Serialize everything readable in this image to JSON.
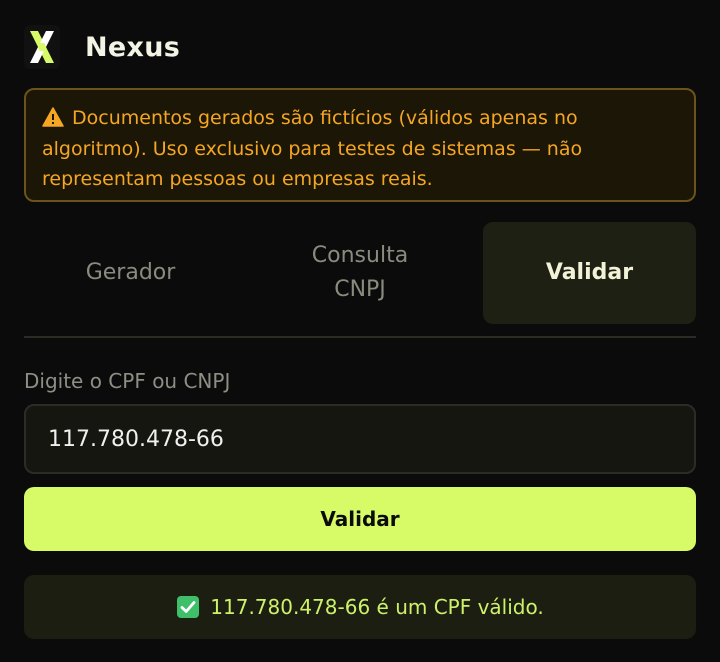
{
  "header": {
    "brand": "Nexus",
    "logo_icon": "x-logo-icon"
  },
  "warning": {
    "icon": "warning-icon",
    "text": "Documentos gerados são fictícios (válidos apenas no algoritmo). Uso exclusivo para testes de sistemas — não representam pessoas ou empresas reais."
  },
  "tabs": [
    {
      "label": "Gerador",
      "active": false
    },
    {
      "label": "Consulta CNPJ",
      "active": false
    },
    {
      "label": "Validar",
      "active": true
    }
  ],
  "form": {
    "label": "Digite o CPF ou CNPJ",
    "value": "117.780.478-66",
    "button_label": "Validar"
  },
  "result": {
    "icon": "check-icon",
    "text": "117.780.478-66 é um CPF válido."
  },
  "colors": {
    "background": "#0b0b0b",
    "accent": "#d6fb66",
    "warning_text": "#f5a623",
    "result_text": "#cdf26a"
  }
}
